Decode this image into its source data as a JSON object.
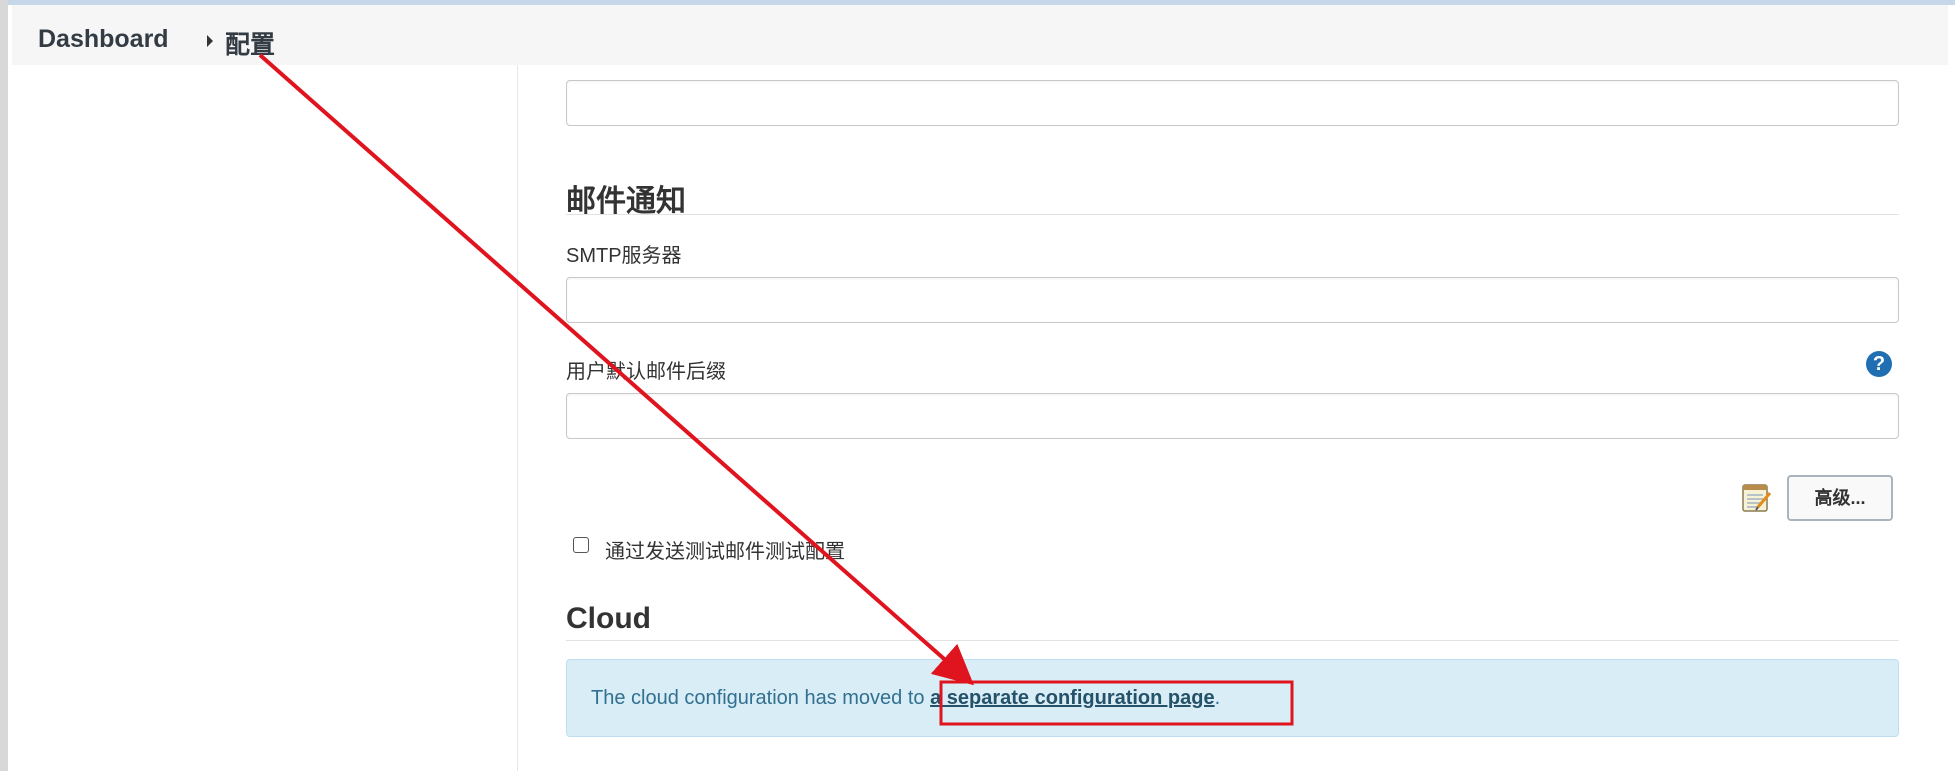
{
  "breadcrumb": {
    "dashboard": "Dashboard",
    "current": "配置"
  },
  "mail": {
    "section_title": "邮件通知",
    "smtp_label": "SMTP服务器",
    "suffix_label": "用户默认邮件后缀",
    "help_symbol": "?",
    "advanced_button": "高级...",
    "test_checkbox_label": "通过发送测试邮件测试配置"
  },
  "cloud": {
    "section_title": "Cloud",
    "message_prefix": "The cloud configuration has moved to ",
    "link_text": "a separate configuration page",
    "message_suffix": "."
  },
  "icons": {
    "breadcrumb_separator": "chevron-right-icon",
    "help": "help-icon",
    "notepad": "notepad-icon"
  },
  "colors": {
    "annotation_red": "#e0141e",
    "alert_bg": "#d9edf7",
    "help_blue": "#1f6fb2"
  }
}
